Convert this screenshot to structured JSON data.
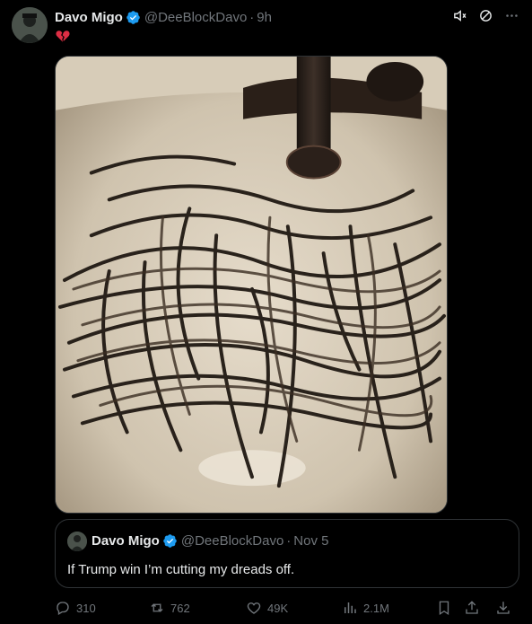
{
  "tweet": {
    "author_name": "Davo Migo",
    "handle": "@DeeBlockDavo",
    "separator": "·",
    "time": "9h",
    "body_emoji": "broken-heart-emoji",
    "media_description_icon": "photo"
  },
  "quote": {
    "author_name": "Davo Migo",
    "handle": "@DeeBlockDavo",
    "separator": "·",
    "time": "Nov 5",
    "text": "If Trump win I’m cutting my dreads off."
  },
  "actions": {
    "replies": "310",
    "reposts": "762",
    "likes": "49K",
    "views": "2.1M"
  },
  "colors": {
    "background": "#000000",
    "text": "#e7e9ea",
    "muted": "#71767b",
    "verified": "#1d9bf0",
    "border": "#2f3336"
  }
}
